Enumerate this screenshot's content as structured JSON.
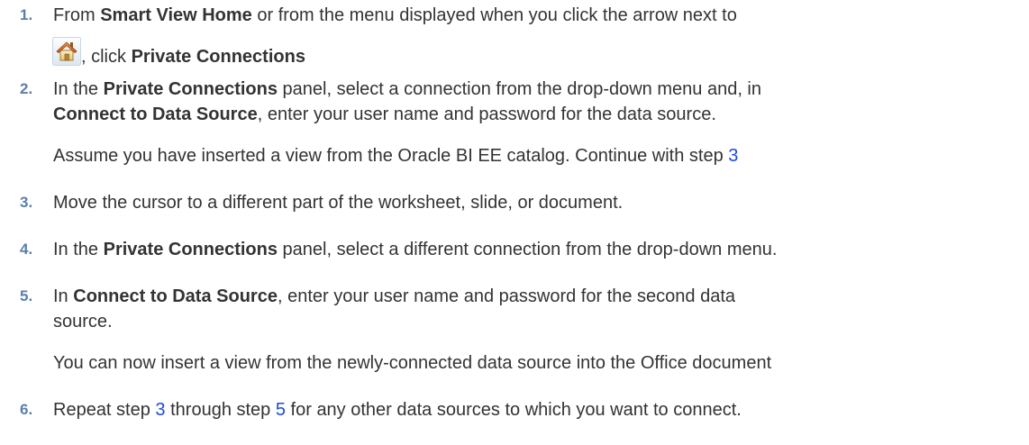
{
  "steps": [
    {
      "number": "1.",
      "t1": "From ",
      "b1": "Smart View Home",
      "t2": " or from the menu displayed when you click the arrow next to",
      "icon": "home-icon",
      "t3": ", click ",
      "b2": "Private Connections"
    },
    {
      "number": "2.",
      "t1": "In the ",
      "b1": "Private Connections",
      "t2": " panel, select a connection from the drop-down menu and, in",
      "b2": "Connect to Data Source",
      "t3": ", enter your user name and password for the data source.",
      "note": "Assume you have inserted a view from the Oracle BI EE catalog. Continue with step ",
      "note_link": "3"
    },
    {
      "number": "3.",
      "t1": "Move the cursor to a different part of the worksheet, slide, or document."
    },
    {
      "number": "4.",
      "t1": "In the ",
      "b1": "Private Connections",
      "t2": " panel, select a different connection from the drop-down menu."
    },
    {
      "number": "5.",
      "t1": "In ",
      "b1": "Connect to Data Source",
      "t2": ", enter your user name and password for the second data",
      "t3": "source.",
      "note": "You can now insert a view from the newly-connected data source into the Office document"
    },
    {
      "number": "6.",
      "t1": "Repeat step ",
      "link1": "3",
      "t2": " through step ",
      "link2": "5",
      "t3": " for any other data sources to which you want to connect."
    }
  ],
  "colors": {
    "text": "#333333",
    "step_number": "#5a7fa8",
    "link": "#1a4bdb"
  }
}
